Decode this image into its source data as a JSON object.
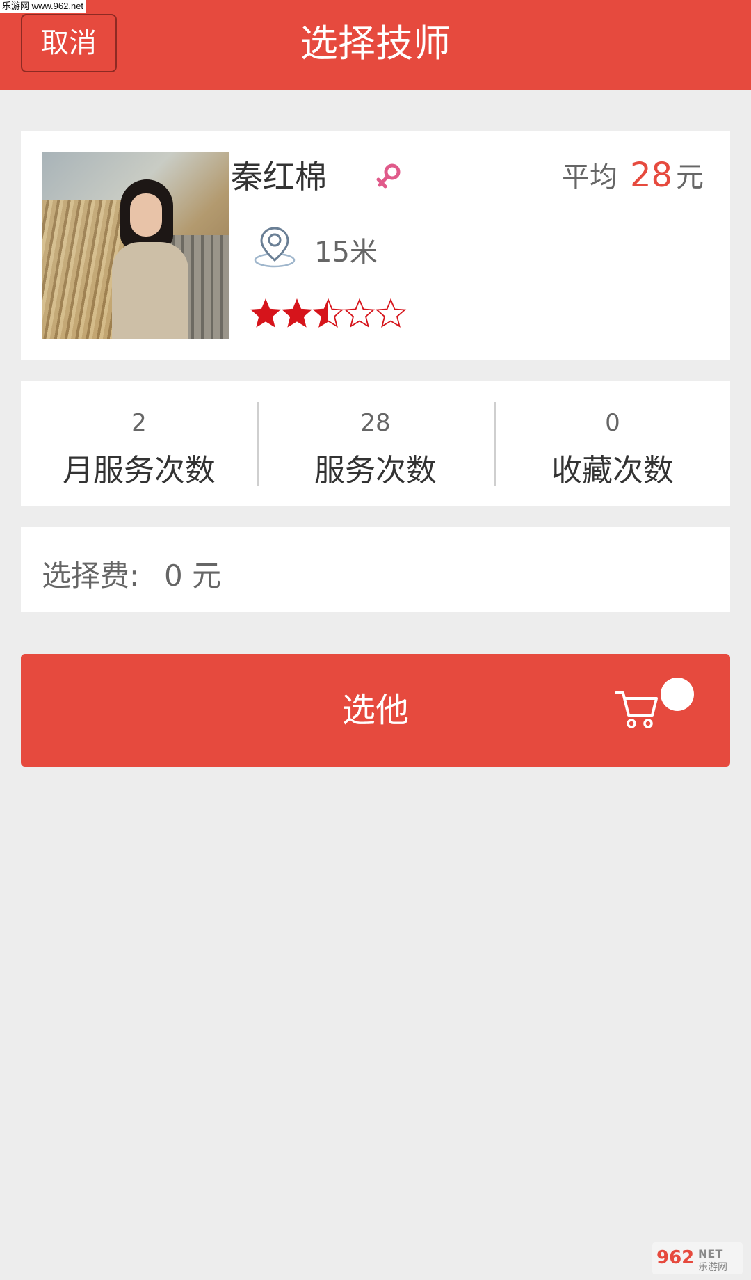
{
  "watermark_top": "乐游网 www.962.net",
  "header": {
    "cancel_label": "取消",
    "title": "选择技师"
  },
  "profile": {
    "name": "秦红棉",
    "gender": "female",
    "avg_label": "平均",
    "avg_price": "28",
    "avg_unit": "元",
    "distance": "15米",
    "rating": 2.5,
    "rating_max": 5
  },
  "stats": [
    {
      "value": "2",
      "label": "月服务次数"
    },
    {
      "value": "28",
      "label": "服务次数"
    },
    {
      "value": "0",
      "label": "收藏次数"
    }
  ],
  "fee": {
    "label": "选择费:",
    "value": "0 元"
  },
  "select_button": {
    "label": "选他",
    "icon": "cart-icon"
  },
  "watermark_bottom": {
    "brand": "962",
    "suffix": "NET",
    "sub": "乐游网"
  },
  "colors": {
    "accent": "#e64a3e",
    "background": "#ededed",
    "star": "#d6141b",
    "gender": "#e05a8a",
    "location": "#6a7f95"
  }
}
